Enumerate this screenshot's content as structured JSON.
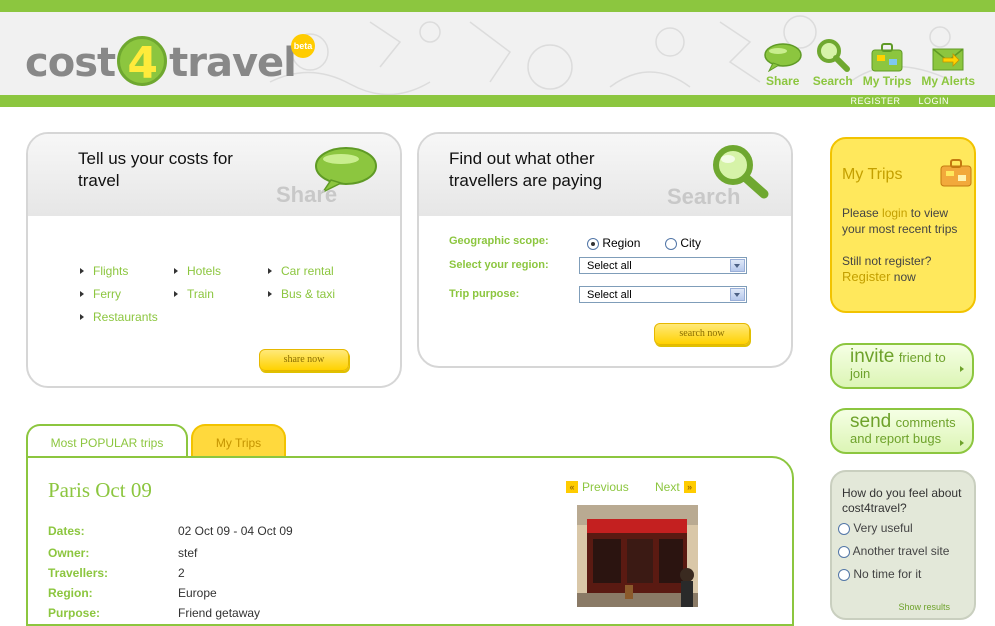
{
  "brand": {
    "logo_left": "cost",
    "logo_digit": "4",
    "logo_right": "travel",
    "beta": "beta"
  },
  "nav": {
    "items": [
      {
        "label": "Share",
        "icon": "speech-bubble-icon"
      },
      {
        "label": "Search",
        "icon": "magnifier-icon"
      },
      {
        "label": "My Trips",
        "icon": "suitcase-icon"
      },
      {
        "label": "My Alerts",
        "icon": "envelope-icon"
      }
    ],
    "register": "REGISTER",
    "login": "LOGIN"
  },
  "share_panel": {
    "title": "Tell us your costs for travel",
    "watermark": "Share",
    "links": [
      "Flights",
      "Hotels",
      "Car rental",
      "Ferry",
      "Train",
      "Bus & taxi",
      "Restaurants"
    ],
    "button": "share now"
  },
  "search_panel": {
    "title": "Find out what other travellers are paying",
    "watermark": "Search",
    "scope_label": "Geographic scope:",
    "scope_options": [
      "Region",
      "City"
    ],
    "scope_selected": "Region",
    "region_label": "Select your region:",
    "region_value": "Select all",
    "purpose_label": "Trip purpose:",
    "purpose_value": "Select all",
    "button": "search now"
  },
  "sidebar": {
    "mytrips": {
      "title": "My Trips",
      "please": "Please",
      "login": "login",
      "view_text": "to view your most recent trips",
      "still": "Still not register?",
      "register": "Register",
      "now": "now"
    },
    "invite": {
      "big": "invite",
      "small": "friend to join"
    },
    "send": {
      "big": "send",
      "small": "comments and report bugs"
    },
    "poll": {
      "question": "How do you feel about cost4travel?",
      "options": [
        "Very useful",
        "Another travel site",
        "No time for it"
      ],
      "results": "Show results"
    }
  },
  "tabs": {
    "popular": "Most POPULAR trips",
    "mytrips": "My Trips"
  },
  "trip": {
    "title": "Paris Oct 09",
    "previous": "Previous",
    "next": "Next",
    "rows": [
      {
        "k": "Dates:",
        "v": "02 Oct 09 - 04 Oct 09"
      },
      {
        "k": "Owner:",
        "v": "stef"
      },
      {
        "k": "Travellers:",
        "v": "2"
      },
      {
        "k": "Region:",
        "v": "Europe"
      },
      {
        "k": "Purpose:",
        "v": "Friend getaway"
      }
    ]
  },
  "colors": {
    "accent": "#8cc63f",
    "yellow": "#ffe85c"
  }
}
